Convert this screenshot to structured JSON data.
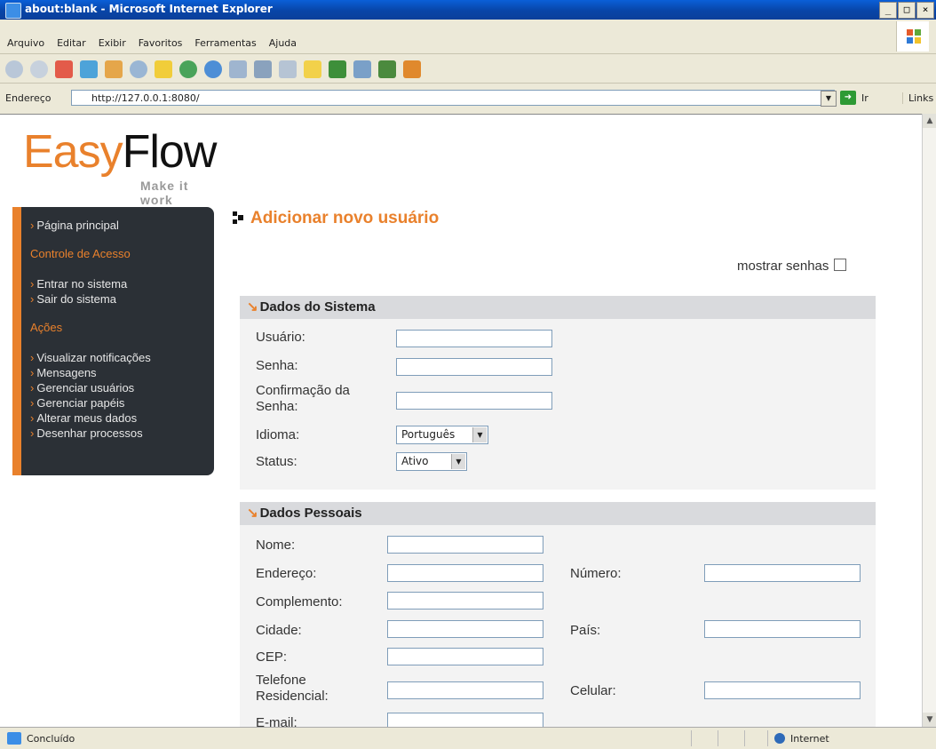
{
  "window": {
    "title": "about:blank - Microsoft Internet Explorer"
  },
  "menu": [
    "Arquivo",
    "Editar",
    "Exibir",
    "Favoritos",
    "Ferramentas",
    "Ajuda"
  ],
  "address": {
    "label": "Endereço",
    "url": "http://127.0.0.1:8080/",
    "go_label": "Ir",
    "links_label": "Links"
  },
  "logo": {
    "part1": "Easy",
    "part2": "Flow",
    "tagline": "Make it work"
  },
  "sidebar": {
    "home": "Página principal",
    "section_access": "Controle de Acesso",
    "login": "Entrar no sistema",
    "logout": "Sair do sistema",
    "section_actions": "Ações",
    "actions": [
      "Visualizar notificações",
      "Mensagens",
      "Gerenciar usuários",
      "Gerenciar papéis",
      "Alterar meus dados",
      "Desenhar processos"
    ]
  },
  "page": {
    "title": "Adicionar novo usuário",
    "show_passwords": "mostrar senhas"
  },
  "system": {
    "header": "Dados do Sistema",
    "user": "Usuário:",
    "password": "Senha:",
    "confirm_line1": "Confirmação da",
    "confirm_line2": "Senha:",
    "language": "Idioma:",
    "language_value": "Português",
    "status": "Status:",
    "status_value": "Ativo"
  },
  "personal": {
    "header": "Dados Pessoais",
    "name": "Nome:",
    "address": "Endereço:",
    "number": "Número:",
    "complement": "Complemento:",
    "city": "Cidade:",
    "country": "País:",
    "zip": "CEP:",
    "phone_line1": "Telefone",
    "phone_line2": "Residencial:",
    "mobile": "Celular:",
    "email": "E-mail:"
  },
  "status": {
    "text": "Concluído",
    "zone": "Internet"
  },
  "colors": {
    "accent": "#e9812c",
    "sidebar_bg": "#2b3036",
    "panel_header": "#d9dadd"
  }
}
